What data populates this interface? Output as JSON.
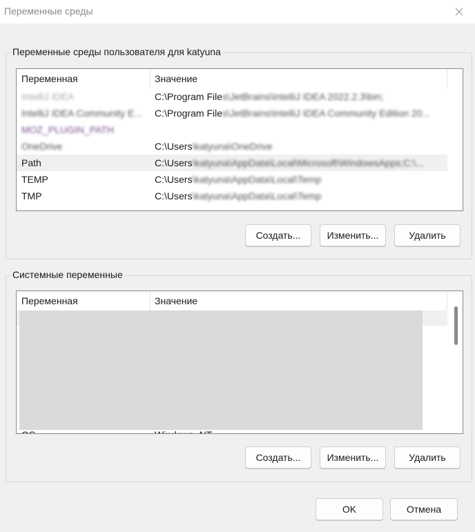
{
  "window": {
    "title": "Переменные среды",
    "close_icon": "close-icon"
  },
  "user_vars": {
    "group_label": "Переменные среды пользователя для katyuna",
    "columns": {
      "name": "Переменная",
      "value": "Значение"
    },
    "rows": [
      {
        "name": "IntelliJ IDEA",
        "value_prefix": "C:\\Program File",
        "value_rest": "s\\JetBrains\\IntelliJ IDEA 2022.2.3\\bin;"
      },
      {
        "name": "IntelliJ IDEA Community E...",
        "value_prefix": "C:\\Program File",
        "value_rest": "s\\JetBrains\\IntelliJ IDEA Community Edition 20..."
      },
      {
        "name": "MOZ_PLUGIN_PATH",
        "value_prefix": "",
        "value_rest": ""
      },
      {
        "name": "OneDrive",
        "value_prefix": "C:\\Users",
        "value_rest": "\\katyuna\\OneDrive"
      },
      {
        "name": "Path",
        "value_prefix": "C:\\Users",
        "value_rest": "\\katyuna\\AppData\\Local\\Microsoft\\WindowsApps;C:\\..."
      },
      {
        "name": "TEMP",
        "value_prefix": "C:\\Users",
        "value_rest": "\\katyuna\\AppData\\Local\\Temp"
      },
      {
        "name": "TMP",
        "value_prefix": "C:\\Users",
        "value_rest": "\\katyuna\\AppData\\Local\\Temp"
      }
    ],
    "buttons": {
      "create": "Создать...",
      "edit": "Изменить...",
      "delete": "Удалить"
    }
  },
  "system_vars": {
    "group_label": "Системные переменные",
    "columns": {
      "name": "Переменная",
      "value": "Значение"
    },
    "partial_row": {
      "name": "OS",
      "value": "Windows_NT"
    },
    "buttons": {
      "create": "Создать...",
      "edit": "Изменить...",
      "delete": "Удалить"
    }
  },
  "footer": {
    "ok": "OK",
    "cancel": "Отмена"
  }
}
